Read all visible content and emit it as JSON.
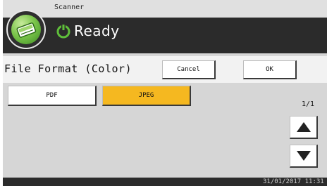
{
  "header": {
    "app_name": "Scanner",
    "status": "Ready"
  },
  "dialog": {
    "title": "File Format (Color)",
    "cancel_label": "Cancel",
    "ok_label": "OK"
  },
  "formats": [
    {
      "label": "PDF",
      "selected": false
    },
    {
      "label": "JPEG",
      "selected": true
    }
  ],
  "pagination": {
    "indicator": "1/1"
  },
  "footer": {
    "datetime": "31/01/2017 11:31"
  },
  "colors": {
    "selected": "#f5b820",
    "header_bg": "#2b2b2b",
    "content_bg": "#d6d6d6",
    "status_icon": "#5fbf3a"
  }
}
